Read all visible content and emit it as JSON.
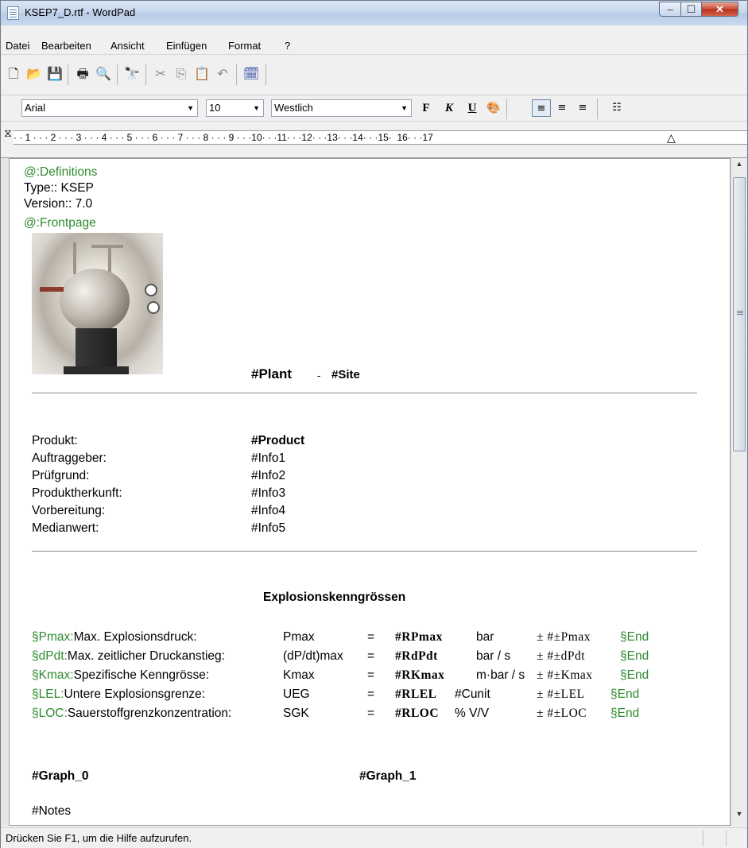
{
  "window": {
    "title": "KSEP7_D.rtf - WordPad",
    "min_label": "–",
    "max_label": "☐",
    "close_label": "✕"
  },
  "menu": {
    "items": [
      "Datei",
      "Bearbeiten",
      "Ansicht",
      "Einfügen",
      "Format",
      "?"
    ]
  },
  "toolbar": {
    "icons": [
      "new-icon",
      "open-icon",
      "save-icon",
      "print-icon",
      "print-preview-icon",
      "find-icon",
      "cut-icon",
      "copy-icon",
      "paste-icon",
      "undo-icon",
      "insert-datetime-icon"
    ]
  },
  "format_bar": {
    "font": "Arial",
    "size": "10",
    "script": "Westlich",
    "bold": "F",
    "italic": "K",
    "underline": "U",
    "color_icon": "color-icon",
    "align_left": "≡",
    "align_center": "≡",
    "align_right": "≡",
    "bullets": "☷"
  },
  "ruler": {
    "text": "· · 1 · · · 2 · · · 3 · · · 4 · · · 5 · · · 6 · · · 7 · · · 8 · · · 9 · · ·10· · ·11· · ·12· · ·13· · ·14· · ·15·  16· · ·17"
  },
  "document": {
    "definitions": "@:Definitions",
    "type": "Type:: KSEP",
    "version": "Version:: 7.0",
    "frontpage": "@:Frontpage",
    "plant": "#Plant",
    "dash": "-",
    "site": "#Site",
    "info_rows": [
      {
        "label": "Produkt:",
        "value": "#Product"
      },
      {
        "label": "Auftraggeber:",
        "value": "#Info1"
      },
      {
        "label": "Prüfgrund:",
        "value": "#Info2"
      },
      {
        "label": "Produktherkunft:",
        "value": "#Info3"
      },
      {
        "label": "Vorbereitung:",
        "value": "#Info4"
      },
      {
        "label": "Medianwert:",
        "value": "#Info5"
      }
    ],
    "section_title": "Explosionskenngrössen",
    "params": [
      {
        "tag": "§Pmax:",
        "desc": "Max. Explosionsdruck:",
        "sym": "Pmax",
        "eq": "=",
        "var": "#RPmax",
        "unit": "bar",
        "pm": "± #±Pmax",
        "end": "§End"
      },
      {
        "tag": "§dPdt:",
        "desc": "Max. zeitlicher Druckanstieg:",
        "sym": "(dP/dt)max",
        "eq": "=",
        "var": "#RdPdt",
        "unit": "bar / s",
        "pm": "± #±dPdt",
        "end": "§End"
      },
      {
        "tag": "§Kmax:",
        "desc": "Spezifische Kenngrösse:",
        "sym": "Kmax",
        "eq": "=",
        "var": "#RKmax",
        "unit": "m·bar / s",
        "pm": "± #±Kmax",
        "end": "§End"
      },
      {
        "tag": "§LEL:",
        "desc": "Untere Explosionsgrenze:",
        "sym": "UEG",
        "eq": "=",
        "var": "#RLEL",
        "unit": "#Cunit",
        "pm": "± #±LEL",
        "end": "§End"
      },
      {
        "tag": "§LOC:",
        "desc": "Sauerstoffgrenzkonzentration:",
        "sym": "SGK",
        "eq": "=",
        "var": "#RLOC",
        "unit": "% V/V",
        "pm": "± #±LOC",
        "end": "§End"
      }
    ],
    "graph0": "#Graph_0",
    "graph1": "#Graph_1",
    "notes": "#Notes"
  },
  "status": {
    "text": "Drücken Sie F1, um die Hilfe aufzurufen."
  },
  "colors": {
    "green_text": "#2e8b2e"
  }
}
